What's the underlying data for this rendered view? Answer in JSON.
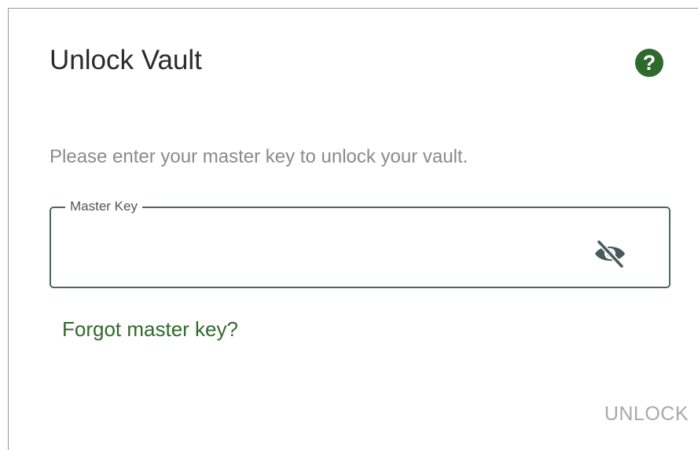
{
  "dialog": {
    "title": "Unlock Vault",
    "help_label": "?",
    "prompt": "Please enter your master key to unlock your vault.",
    "master_key_field": {
      "label": "Master Key",
      "value": "",
      "placeholder": "",
      "visibility_icon": "eye-off-icon"
    },
    "forgot_link": "Forgot master key?",
    "unlock_button": "UNLOCK"
  },
  "colors": {
    "accent_green": "#2f6a2d",
    "field_border": "#4e6466",
    "muted_text": "#8a8a8a",
    "disabled_button": "#a9a9a9"
  }
}
